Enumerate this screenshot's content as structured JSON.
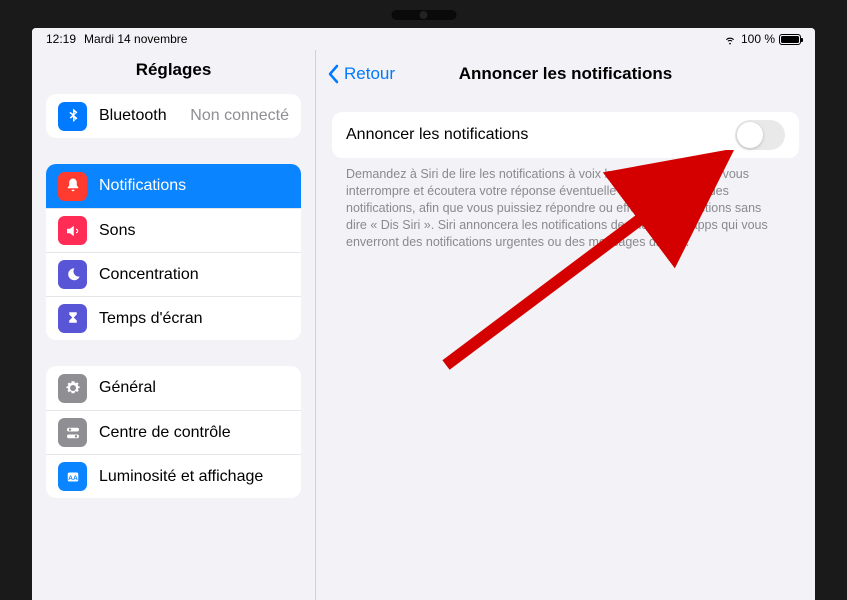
{
  "status": {
    "time": "12:19",
    "date": "Mardi 14 novembre",
    "battery_pct": "100 %"
  },
  "sidebar": {
    "title": "Réglages",
    "group0": {
      "bluetooth": {
        "label": "Bluetooth",
        "detail": "Non connecté"
      }
    },
    "group1": {
      "notifications": "Notifications",
      "sounds": "Sons",
      "focus": "Concentration",
      "screentime": "Temps d'écran"
    },
    "group2": {
      "general": "Général",
      "control": "Centre de contrôle",
      "display": "Luminosité et affichage"
    }
  },
  "detail": {
    "back": "Retour",
    "title": "Annoncer les notifications",
    "toggle_label": "Annoncer les notifications",
    "footer": "Demandez à Siri de lire les notifications à voix haute. Siri évitera de vous interrompre et écoutera votre réponse éventuelle après la lecture des notifications, afin que vous puissiez répondre ou effectuer des actions sans dire « Dis Siri ». Siri annoncera les notifications des nouvelles apps qui vous enverront des notifications urgentes ou des messages directs."
  }
}
